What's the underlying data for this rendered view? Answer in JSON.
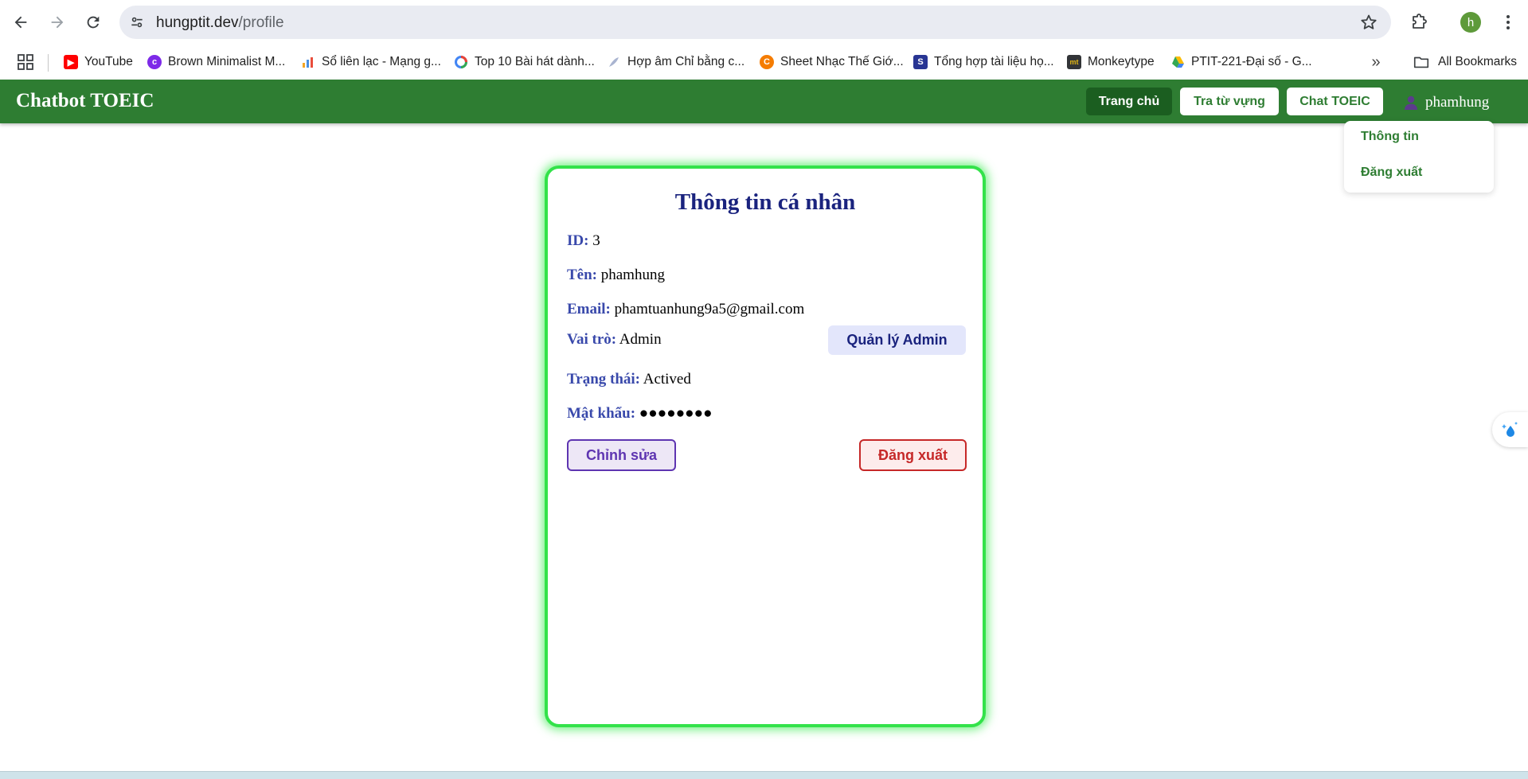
{
  "browser": {
    "url_host": "hungptit.dev",
    "url_path": "/profile",
    "profile_initial": "h",
    "bookmarks": [
      {
        "label": "YouTube",
        "icon": "youtube-icon",
        "color": "#ff0000"
      },
      {
        "label": "Brown Minimalist M...",
        "icon": "canva-icon",
        "color": "#7d2ae8"
      },
      {
        "label": "Sổ liên lạc - Mạng g...",
        "icon": "chart-icon",
        "color": "#f5a623"
      },
      {
        "label": "Top 10 Bài hát dành...",
        "icon": "ring-icon",
        "color": "#4285f4"
      },
      {
        "label": "Hợp âm Chỉ bằng c...",
        "icon": "feather-icon",
        "color": "#a9b4d0"
      },
      {
        "label": "Sheet Nhạc Thế Giớ...",
        "icon": "c-logo-icon",
        "color": "#f57c00"
      },
      {
        "label": "Tổng hợp tài liệu họ...",
        "icon": "s-logo-icon",
        "color": "#283593"
      },
      {
        "label": "Monkeytype",
        "icon": "monkeytype-icon",
        "color": "#323437"
      },
      {
        "label": "PTIT-221-Đại số - G...",
        "icon": "google-drive-icon",
        "color": "#0f9d58"
      }
    ],
    "all_bookmarks_label": "All Bookmarks"
  },
  "header": {
    "brand": "Chatbot TOEIC",
    "nav": [
      {
        "label": "Trang chủ",
        "active": true
      },
      {
        "label": "Tra từ vựng",
        "active": false
      },
      {
        "label": "Chat TOEIC",
        "active": false
      }
    ],
    "username": "phamhung",
    "dropdown": [
      "Thông tin",
      "Đăng xuất"
    ]
  },
  "profile": {
    "title": "Thông tin cá nhân",
    "fields": [
      {
        "label": "ID:",
        "value": "3"
      },
      {
        "label": "Tên:",
        "value": "phamhung"
      },
      {
        "label": "Email:",
        "value": "phamtuanhung9a5@gmail.com"
      },
      {
        "label": "Vai trò:",
        "value": "Admin"
      },
      {
        "label": "Trạng thái:",
        "value": "Actived"
      },
      {
        "label": "Mật khẩu:",
        "value": "●●●●●●●●"
      }
    ],
    "admin_button": "Quản lý Admin",
    "edit_button": "Chỉnh sửa",
    "logout_button": "Đăng xuất"
  },
  "colors": {
    "header_green": "#2e7d32",
    "active_nav": "#1b5e20",
    "card_glow": "#33e24a",
    "title_navy": "#1a237e",
    "label_indigo": "#3949ab"
  }
}
